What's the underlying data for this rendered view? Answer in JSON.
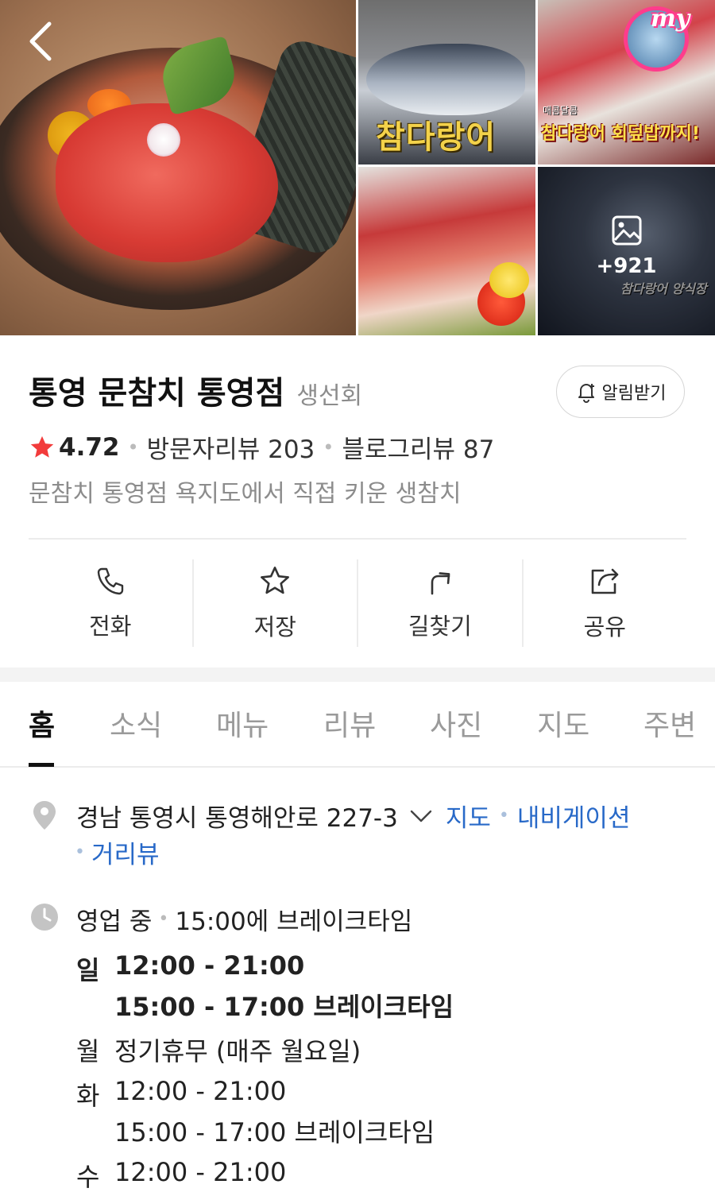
{
  "gallery": {
    "photo_captions": {
      "top_middle": "참다랑어",
      "top_right": "참다랑어 회덮밥까지!",
      "top_right_sub": "매콤달콤",
      "top_right_logo": "my",
      "bottom_right": "참다랑어 양식장"
    },
    "more_count": "+921"
  },
  "place": {
    "name": "통영 문참치 통영점",
    "category": "생선회",
    "alarm_label": "알림받기",
    "rating": "4.72",
    "visitor_reviews": "방문자리뷰 203",
    "blog_reviews": "블로그리뷰 87",
    "description": "문참치 통영점 욕지도에서 직접 키운 생참치"
  },
  "actions": [
    {
      "label": "전화",
      "icon": "phone-icon"
    },
    {
      "label": "저장",
      "icon": "star-outline-icon"
    },
    {
      "label": "길찾기",
      "icon": "directions-arrow-icon"
    },
    {
      "label": "공유",
      "icon": "share-icon"
    }
  ],
  "tabs": [
    "홈",
    "소식",
    "메뉴",
    "리뷰",
    "사진",
    "지도",
    "주변"
  ],
  "active_tab": "홈",
  "address": {
    "text": "경남 통영시 통영해안로 227-3",
    "links": [
      "지도",
      "내비게이션",
      "거리뷰"
    ]
  },
  "hours": {
    "status": "영업 중",
    "status_detail": "15:00에 브레이크타임",
    "schedule": [
      {
        "day": "일",
        "time": "12:00 - 21:00",
        "break": "15:00 - 17:00 브레이크타임"
      },
      {
        "day": "월",
        "time": "정기휴무 (매주 월요일)"
      },
      {
        "day": "화",
        "time": "12:00 - 21:00",
        "break": "15:00 - 17:00 브레이크타임"
      },
      {
        "day": "수",
        "time": "12:00 - 21:00"
      }
    ]
  },
  "colors": {
    "star": "#f23b3b",
    "link": "#2869c8",
    "muted_text": "#8c8c8c",
    "divider": "#ececec"
  }
}
